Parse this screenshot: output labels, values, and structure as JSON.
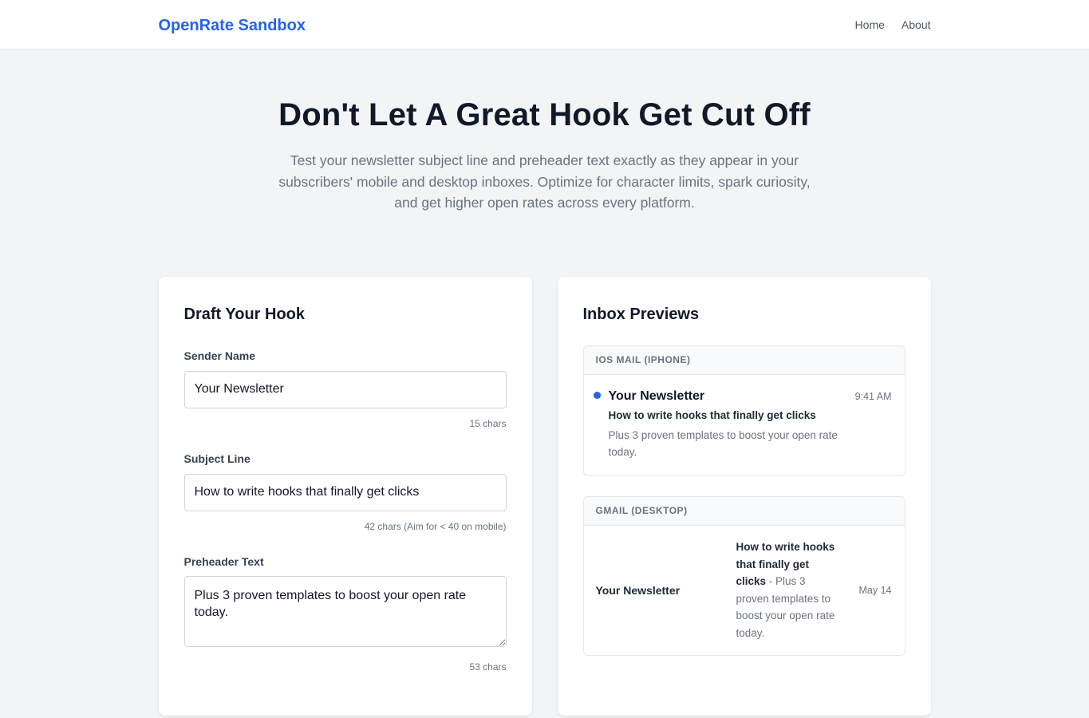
{
  "header": {
    "brand": "OpenRate Sandbox",
    "nav": [
      {
        "label": "Home"
      },
      {
        "label": "About"
      }
    ]
  },
  "hero": {
    "title": "Don't Let A Great Hook Get Cut Off",
    "subtitle": "Test your newsletter subject line and preheader text exactly as they appear in your subscribers' mobile and desktop inboxes. Optimize for character limits, spark curiosity, and get higher open rates across every platform."
  },
  "draft": {
    "heading": "Draft Your Hook",
    "sender": {
      "label": "Sender Name",
      "value": "Your Newsletter",
      "counter": "15 chars"
    },
    "subject": {
      "label": "Subject Line",
      "value": "How to write hooks that finally get clicks",
      "counter": "42 chars (Aim for < 40 on mobile)"
    },
    "preheader": {
      "label": "Preheader Text",
      "value": "Plus 3 proven templates to boost your open rate today.",
      "counter": "53 chars"
    }
  },
  "previews": {
    "heading": "Inbox Previews",
    "ios": {
      "label": "IOS MAIL (IPHONE)",
      "sender": "Your Newsletter",
      "time": "9:41 AM",
      "subject": "How to write hooks that finally get clicks",
      "preheader": "Plus 3 proven templates to boost your open rate today.",
      "unread_color": "#2563eb"
    },
    "gmail": {
      "label": "GMAIL (DESKTOP)",
      "sender": "Your Newsletter",
      "subject": "How to write hooks that finally get clicks",
      "separator": " - ",
      "preheader": "Plus 3 proven templates to boost your open rate today.",
      "date": "May 14"
    }
  },
  "colors": {
    "accent": "#2563eb",
    "background": "#f3f4f6",
    "card": "#ffffff"
  }
}
